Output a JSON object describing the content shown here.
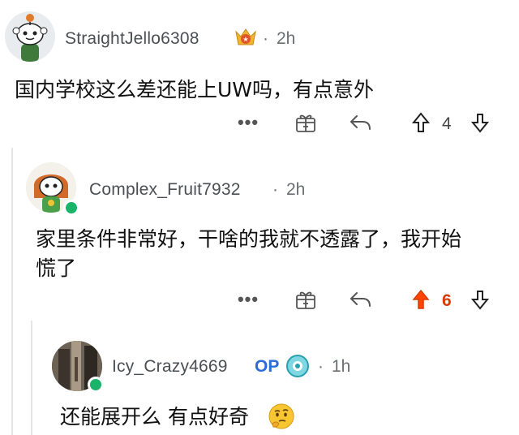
{
  "comments": [
    {
      "username": "StraightJello6308",
      "dot": "·",
      "time": "2h",
      "text": "国内学校这么差还能上UW吗，有点意外",
      "actions": {
        "more": "•••",
        "votes": "4"
      }
    },
    {
      "username": "Complex_Fruit7932",
      "dot": "·",
      "time": "2h",
      "text_line1": "家里条件非常好，干啥的我就不透露了，我开始",
      "text_line2": "慌了",
      "actions": {
        "more": "•••",
        "votes": "6"
      },
      "vote_color": "#d93a00"
    },
    {
      "username": "Icy_Crazy4669",
      "op": "OP",
      "dot": "·",
      "time": "1h",
      "text": "还能展开么 有点好奇"
    }
  ],
  "icons": [
    "award-badge-icon",
    "gift-icon",
    "reply-icon",
    "upvote-icon",
    "downvote-icon",
    "emoji-thinking-icon",
    "flair-badge-icon"
  ]
}
